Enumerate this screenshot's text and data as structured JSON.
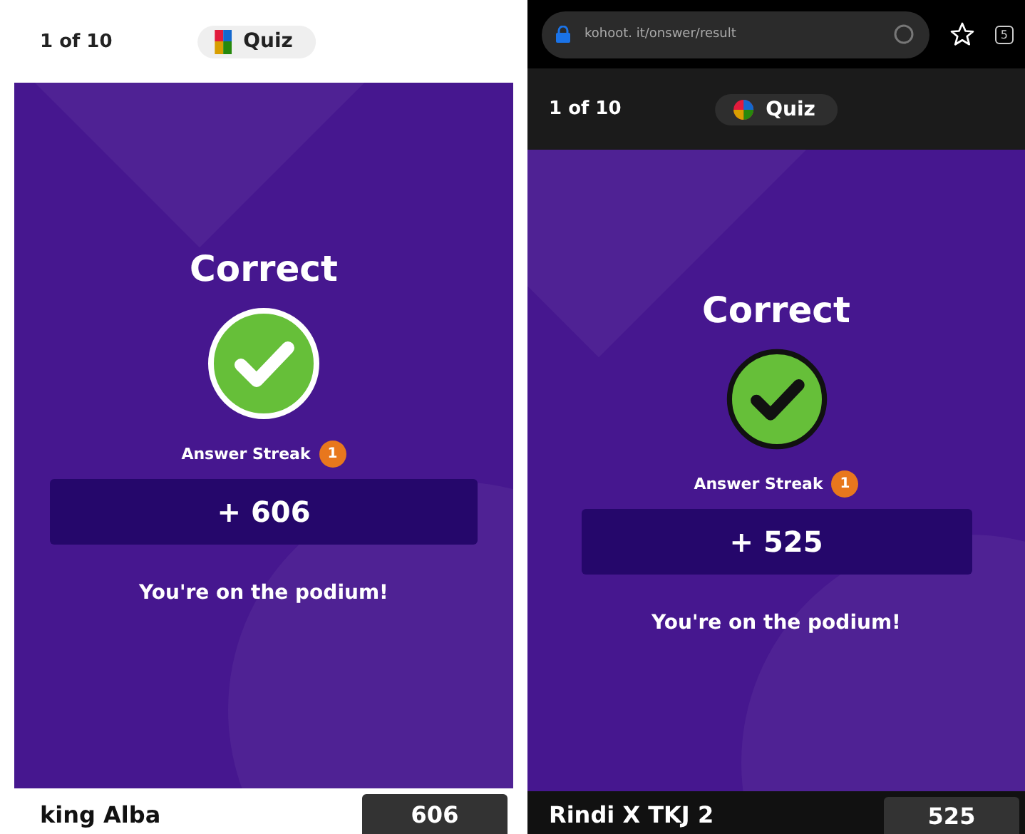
{
  "screens": [
    {
      "kind": "light",
      "counter": "1 of 10",
      "mode": "Quiz",
      "result": "Correct",
      "correct": true,
      "streak_label": "Answer Streak",
      "streak_count": "1",
      "points": "+ 606",
      "message": "You're on the podium!",
      "player": "king Alba",
      "score": "606"
    },
    {
      "kind": "dark",
      "browser": {
        "url": "kohoot. it/onswer/result",
        "tab_count": "5"
      },
      "counter": "1 of 10",
      "mode": "Quiz",
      "result": "Correct",
      "correct": true,
      "streak_label": "Answer Streak",
      "streak_count": "1",
      "points": "+ 525",
      "message": "You're on the podium!",
      "player": "Rindi X TKJ 2",
      "score": "525"
    }
  ]
}
